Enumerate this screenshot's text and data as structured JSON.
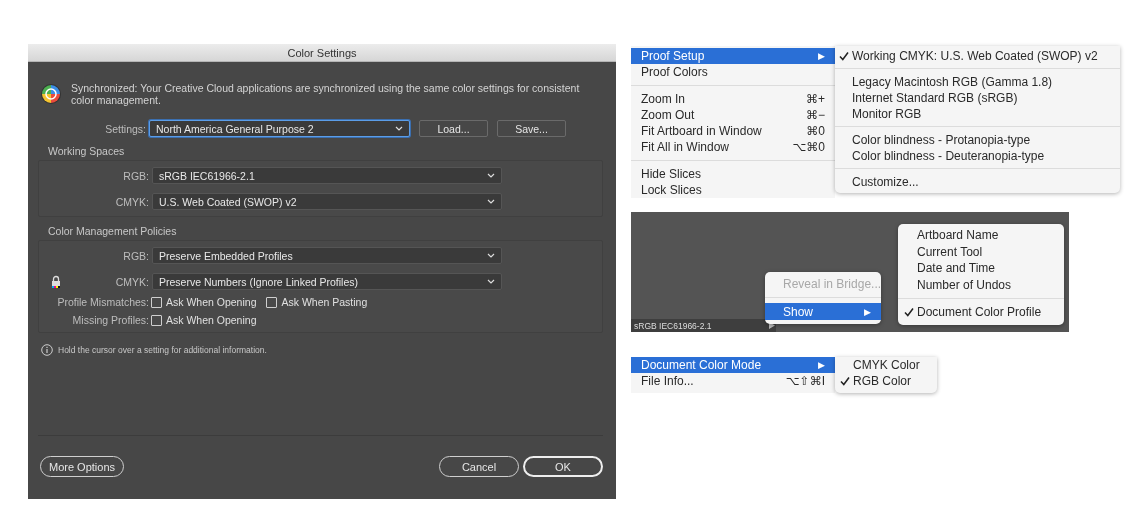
{
  "dialog": {
    "title": "Color Settings",
    "sync_message": "Synchronized: Your Creative Cloud applications are synchronized using the same color settings for consistent color management.",
    "settings": {
      "label": "Settings:",
      "value": "North America General Purpose 2",
      "focused": true
    },
    "settings_buttons": [
      "Load...",
      "Save..."
    ],
    "working_spaces": {
      "title": "Working Spaces",
      "rows": [
        {
          "label": "RGB:",
          "value": "sRGB IEC61966-2.1"
        },
        {
          "label": "CMYK:",
          "value": "U.S. Web Coated (SWOP) v2"
        }
      ]
    },
    "policies": {
      "title": "Color Management Policies",
      "rows": [
        {
          "label": "RGB:",
          "value": "Preserve Embedded Profiles",
          "locked": false
        },
        {
          "label": "CMYK:",
          "value": "Preserve Numbers (Ignore Linked Profiles)",
          "locked": true
        }
      ],
      "checkbox_rows": [
        {
          "label": "Profile Mismatches:",
          "options": [
            {
              "label": "Ask When Opening",
              "checked": false
            },
            {
              "label": "Ask When Pasting",
              "checked": false
            }
          ]
        },
        {
          "label": "Missing Profiles:",
          "options": [
            {
              "label": "Ask When Opening",
              "checked": false
            }
          ]
        }
      ]
    },
    "info": "Hold the cursor over a setting for additional information.",
    "more_options": "More Options",
    "footer_buttons": [
      {
        "label": "Cancel",
        "default": false
      },
      {
        "label": "OK",
        "default": true
      }
    ]
  },
  "view_menu": {
    "items": [
      {
        "kind": "item",
        "label": "Proof Setup",
        "selected": true,
        "submenu_arrow": "▶"
      },
      {
        "kind": "item",
        "label": "Proof Colors",
        "selected": false
      },
      {
        "kind": "separator"
      },
      {
        "kind": "item",
        "label": "Zoom In",
        "shortcut": "⌘+",
        "selected": false
      },
      {
        "kind": "item",
        "label": "Zoom Out",
        "shortcut": "⌘−",
        "selected": false
      },
      {
        "kind": "item",
        "label": "Fit Artboard in Window",
        "shortcut": "⌘0",
        "selected": false
      },
      {
        "kind": "item",
        "label": "Fit All in Window",
        "shortcut": "⌥⌘0",
        "selected": false
      },
      {
        "kind": "separator"
      },
      {
        "kind": "item",
        "label": "Hide Slices",
        "selected": false
      },
      {
        "kind": "item",
        "label": "Lock Slices",
        "selected": false
      }
    ],
    "submenu": [
      {
        "kind": "item",
        "label": "Working CMYK: U.S. Web Coated (SWOP) v2",
        "checked": true
      },
      {
        "kind": "separator"
      },
      {
        "kind": "item",
        "label": "Legacy Macintosh RGB (Gamma 1.8)",
        "checked": false
      },
      {
        "kind": "item",
        "label": "Internet Standard RGB (sRGB)",
        "checked": false
      },
      {
        "kind": "item",
        "label": "Monitor RGB",
        "checked": false
      },
      {
        "kind": "separator"
      },
      {
        "kind": "item",
        "label": "Color blindness - Protanopia-type",
        "checked": false
      },
      {
        "kind": "item",
        "label": "Color blindness - Deuteranopia-type",
        "checked": false
      },
      {
        "kind": "separator"
      },
      {
        "kind": "item",
        "label": "Customize...",
        "checked": false
      }
    ]
  },
  "status_bar_menu": {
    "status_text": "sRGB IEC61966-2.1",
    "items": [
      {
        "kind": "item",
        "label": "Reveal in Bridge...",
        "selected": false,
        "disabled": true
      },
      {
        "kind": "separator"
      },
      {
        "kind": "item",
        "label": "Show",
        "selected": true,
        "submenu_arrow": "▶"
      }
    ],
    "submenu": [
      {
        "kind": "item",
        "label": "Artboard Name",
        "checked": false
      },
      {
        "kind": "item",
        "label": "Current Tool",
        "checked": false
      },
      {
        "kind": "item",
        "label": "Date and Time",
        "checked": false
      },
      {
        "kind": "item",
        "label": "Number of Undos",
        "checked": false
      },
      {
        "kind": "separator"
      },
      {
        "kind": "item",
        "label": "Document Color Profile",
        "checked": true
      }
    ]
  },
  "file_menu": {
    "items": [
      {
        "kind": "item",
        "label": "Document Color Mode",
        "selected": true,
        "submenu_arrow": "▶"
      },
      {
        "kind": "item",
        "label": "File Info...",
        "shortcut": "⌥⇧⌘I",
        "selected": false
      }
    ],
    "submenu": [
      {
        "kind": "item",
        "label": "CMYK Color",
        "checked": false
      },
      {
        "kind": "item",
        "label": "RGB Color",
        "checked": true
      }
    ]
  }
}
